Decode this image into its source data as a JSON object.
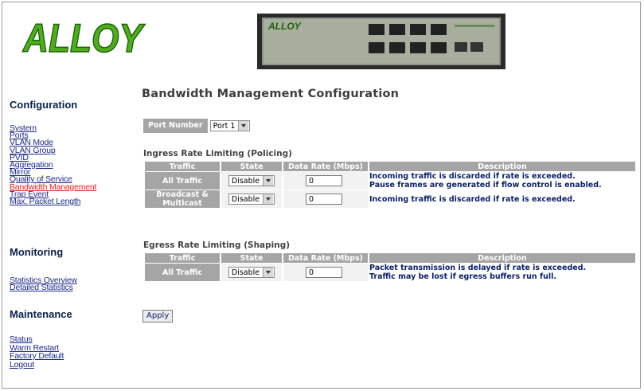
{
  "brand": {
    "logo_text": "ALLOY",
    "accent": "#4caf1a",
    "device_label": "ALLOY"
  },
  "sidebar": {
    "configuration": {
      "title": "Configuration",
      "items": [
        "System",
        "Ports",
        "VLAN Mode",
        "VLAN Group",
        "PVID",
        "Aggregation",
        "Mirror",
        "Quality of Service",
        "Bandwidth Management",
        "Trap Event",
        "Max. Packet Length"
      ],
      "active": "Bandwidth Management"
    },
    "monitoring": {
      "title": "Monitoring",
      "items": [
        "Statistics Overview",
        "Detailed Statistics"
      ]
    },
    "maintenance": {
      "title": "Maintenance",
      "items": [
        "Status",
        "Warm Restart",
        "Factory Default",
        "Logout"
      ]
    }
  },
  "main": {
    "title": "Bandwidth Management Configuration",
    "port_number_label": "Port Number",
    "port_value": "Port 1",
    "ingress": {
      "caption": "Ingress Rate Limiting (Policing)",
      "headers": [
        "Traffic",
        "State",
        "Data Rate (Mbps)",
        "Description"
      ],
      "rows": [
        {
          "traffic": "All Traffic",
          "state": "Disable",
          "rate": "0",
          "desc1": "Incoming traffic is discarded if rate is exceeded.",
          "desc2": "Pause frames are generated if flow control is enabled."
        },
        {
          "traffic1": "Broadcast &",
          "traffic2": "Multicast",
          "state": "Disable",
          "rate": "0",
          "desc1": "Incoming traffic is discarded if rate is exceeded."
        }
      ]
    },
    "egress": {
      "caption": "Egress Rate Limiting (Shaping)",
      "headers": [
        "Traffic",
        "State",
        "Data Rate (Mbps)",
        "Description"
      ],
      "rows": [
        {
          "traffic": "All Traffic",
          "state": "Disable",
          "rate": "0",
          "desc1": "Packet transmission is delayed if rate is exceeded.",
          "desc2": "Traffic may be lost if egress buffers run full."
        }
      ]
    },
    "apply_label": "Apply"
  }
}
